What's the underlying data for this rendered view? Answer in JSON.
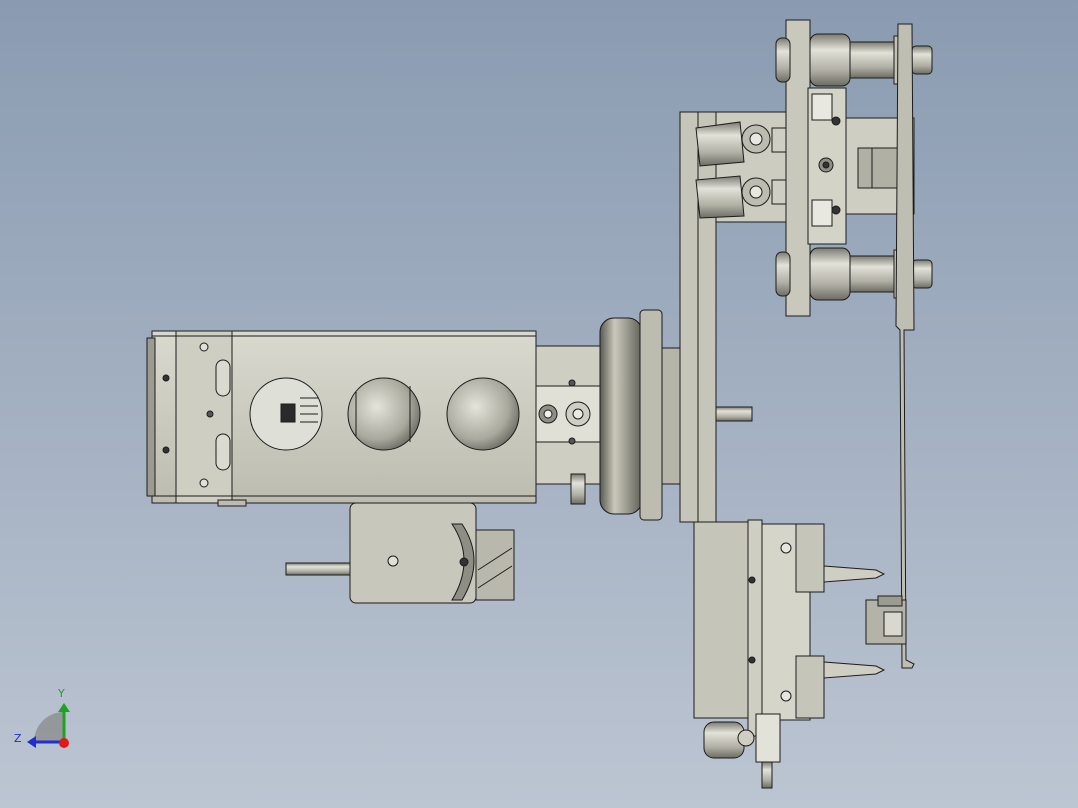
{
  "viewport": {
    "background_top": "#8a9bb1",
    "background_bottom": "#bcc5d2",
    "part_fill": "#c9c8bb",
    "part_fill_light": "#dcdcd2",
    "part_fill_dark": "#8e8e84",
    "edge_color": "#1c1c1c"
  },
  "triad": {
    "y_label": "Y",
    "z_label": "Z",
    "y_color": "#1fa31f",
    "z_color": "#1f2fd0",
    "x_color": "#e01a1a"
  }
}
